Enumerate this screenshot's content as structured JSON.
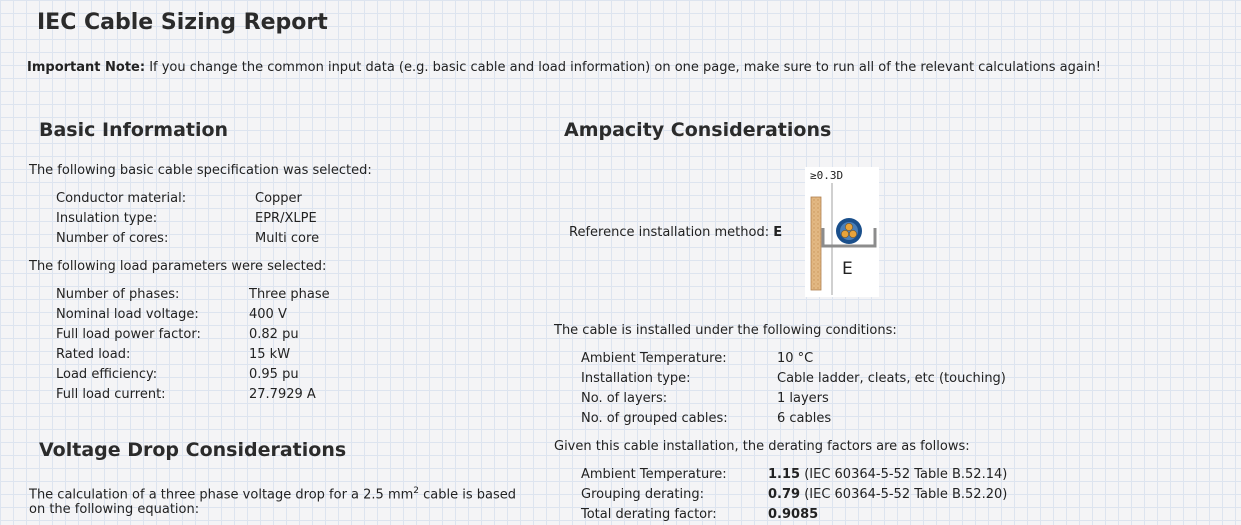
{
  "title": "IEC Cable Sizing Report",
  "note": {
    "label": "Important Note:",
    "text": " If you change the common input data (e.g. basic cable and load information) on one page, make sure to run all of the relevant calculations again!"
  },
  "basic": {
    "heading": "Basic Information",
    "cable_intro": "The following basic cable specification was selected:",
    "cable_rows": [
      {
        "k": "Conductor material:",
        "v": "Copper"
      },
      {
        "k": "Insulation type:",
        "v": "EPR/XLPE"
      },
      {
        "k": "Number of cores:",
        "v": "Multi core"
      }
    ],
    "load_intro": "The following load parameters were selected:",
    "load_rows": [
      {
        "k": "Number of phases:",
        "v": "Three phase"
      },
      {
        "k": "Nominal load voltage:",
        "v": "400 V"
      },
      {
        "k": "Full load power factor:",
        "v": "0.82 pu"
      },
      {
        "k": "Rated load:",
        "v": "15 kW"
      },
      {
        "k": "Load efficiency:",
        "v": "0.95 pu"
      },
      {
        "k": "Full load current:",
        "v": "27.7929 A"
      }
    ]
  },
  "voltage": {
    "heading": "Voltage Drop Considerations",
    "line1_pre": "The calculation of a three phase voltage drop for a 2.5 mm",
    "line1_sup": "2",
    "line1_post": " cable is based",
    "line2": "on the following equation:"
  },
  "ampacity": {
    "heading": "Ampacity Considerations",
    "ref_label": "Reference installation method: ",
    "ref_value": "E",
    "diagram": {
      "top_label": "≥0.3D",
      "method_letter": "E"
    },
    "install_intro": "The cable is installed under the following conditions:",
    "install_rows": [
      {
        "k": "Ambient Temperature:",
        "v": "10 °C"
      },
      {
        "k": "Installation type:",
        "v": "Cable ladder, cleats, etc (touching)"
      },
      {
        "k": "No. of layers:",
        "v": "1 layers"
      },
      {
        "k": "No. of grouped cables:",
        "v": "6 cables"
      }
    ],
    "derate_intro": "Given this cable installation, the derating factors are as follows:",
    "derate_rows": [
      {
        "k": "Ambient Temperature:",
        "v": "1.15",
        "ref": " (IEC 60364-5-52 Table B.52.14)"
      },
      {
        "k": "Grouping derating:",
        "v": "0.79",
        "ref": " (IEC 60364-5-52 Table B.52.20)"
      },
      {
        "k": "Total derating factor:",
        "v": "0.9085",
        "ref": ""
      }
    ]
  }
}
